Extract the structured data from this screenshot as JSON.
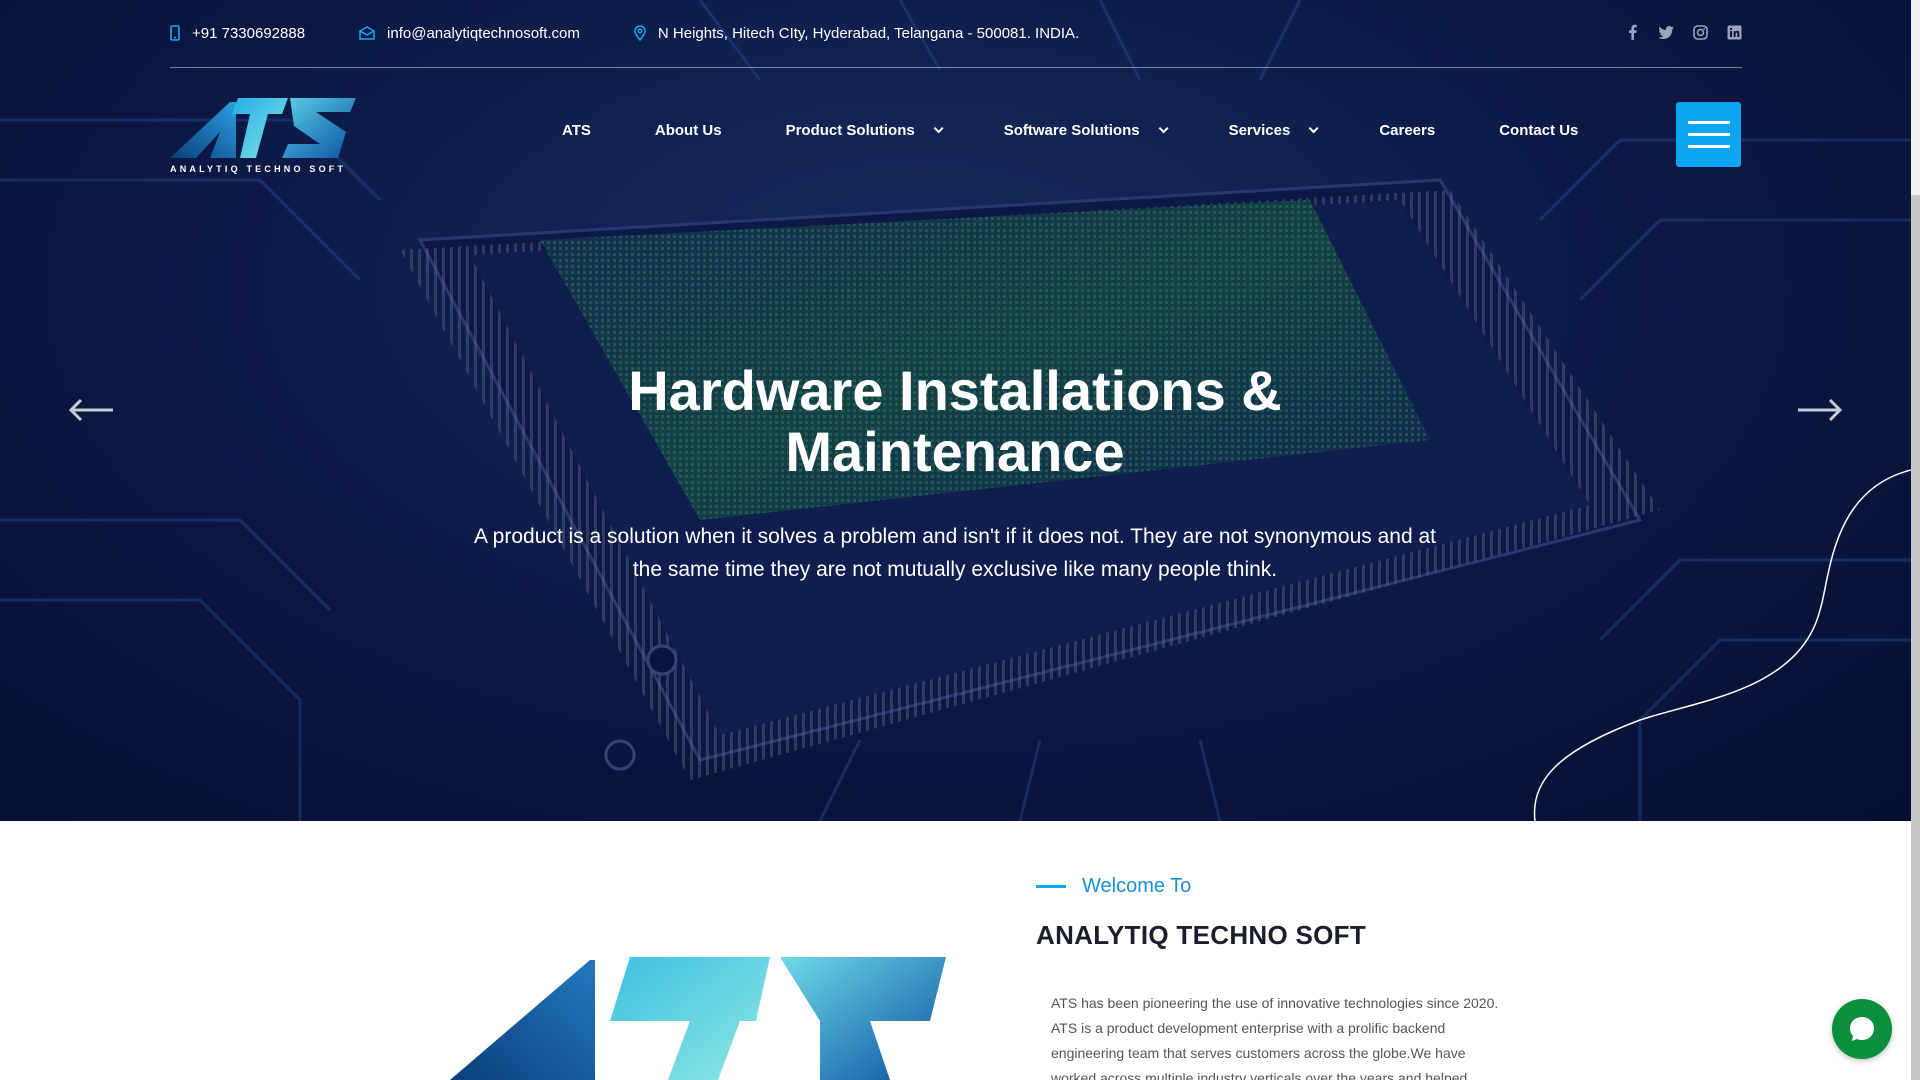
{
  "topbar": {
    "phone": "+91 7330692888",
    "email": "info@analytiqtechnosoft.com",
    "address": "N Heights, Hitech CIty, Hyderabad, Telangana - 500081. INDIA.",
    "social_icons": [
      "facebook-icon",
      "twitter-icon",
      "instagram-icon",
      "linkedin-icon"
    ]
  },
  "logo": {
    "text": "ANALYTIQ TECHNO SOFT"
  },
  "nav": {
    "items": [
      {
        "label": "ATS",
        "dropdown": false
      },
      {
        "label": "About Us",
        "dropdown": false
      },
      {
        "label": "Product Solutions",
        "dropdown": true
      },
      {
        "label": "Software Solutions",
        "dropdown": true
      },
      {
        "label": "Services",
        "dropdown": true
      },
      {
        "label": "Careers",
        "dropdown": false
      },
      {
        "label": "Contact Us",
        "dropdown": false
      }
    ]
  },
  "hero": {
    "title_line1": "Hardware Installations &",
    "title_line2": "Maintenance",
    "text": "A product is a solution when it solves a problem and isn't if it does not. They are not synonymous and at the same time they are not mutually exclusive like many people think."
  },
  "welcome": {
    "label": "Welcome To",
    "title": "ANALYTIQ TECHNO SOFT",
    "body": "ATS has been pioneering the use of innovative technologies since 2020. ATS is a product development enterprise with a prolific backend engineering team that serves customers across the globe.We have worked across multiple industry verticals over the years and helped"
  },
  "colors": {
    "accent": "#0ea5f0",
    "heading_dark": "#1b1f2b",
    "chat_green": "#0a8f3f"
  }
}
